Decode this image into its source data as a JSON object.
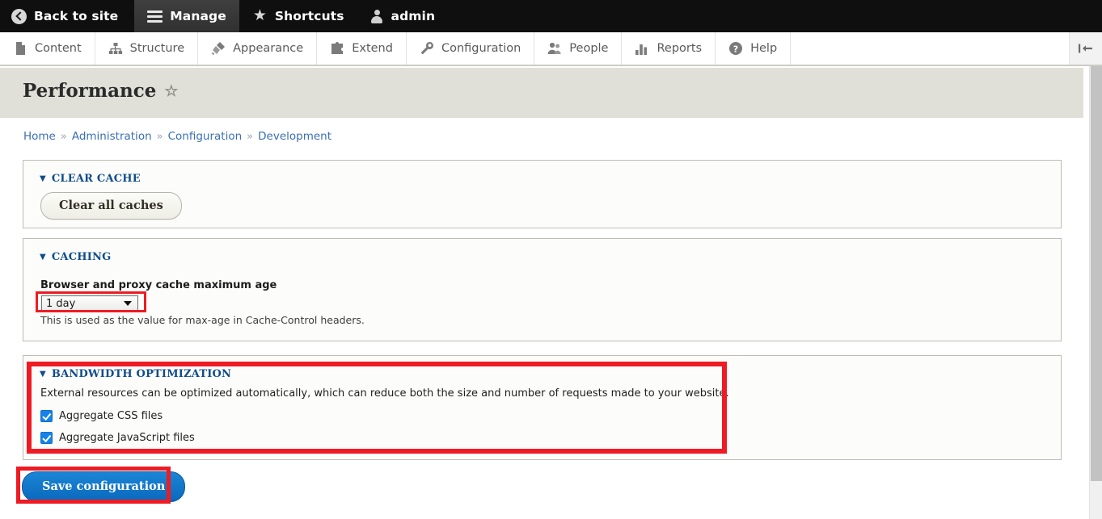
{
  "admin_bar": {
    "items": [
      {
        "label": "Back to site",
        "icon": "back-circle-icon",
        "active": false
      },
      {
        "label": "Manage",
        "icon": "hamburger-icon",
        "active": true
      },
      {
        "label": "Shortcuts",
        "icon": "star-icon",
        "active": false
      },
      {
        "label": "admin",
        "icon": "person-icon",
        "active": false
      }
    ]
  },
  "menu_bar": {
    "items": [
      {
        "label": "Content",
        "icon": "document-icon"
      },
      {
        "label": "Structure",
        "icon": "sitemap-icon"
      },
      {
        "label": "Appearance",
        "icon": "paintbrush-icon"
      },
      {
        "label": "Extend",
        "icon": "puzzle-icon"
      },
      {
        "label": "Configuration",
        "icon": "wrench-icon"
      },
      {
        "label": "People",
        "icon": "people-icon"
      },
      {
        "label": "Reports",
        "icon": "bar-chart-icon"
      },
      {
        "label": "Help",
        "icon": "question-mark-icon"
      }
    ],
    "collapse_icon": "collapse-toolbar-icon"
  },
  "page": {
    "title": "Performance",
    "favorite_icon": "star-outline-icon"
  },
  "breadcrumb": {
    "items": [
      "Home",
      "Administration",
      "Configuration",
      "Development"
    ],
    "separator": "»"
  },
  "clear_cache": {
    "legend": "CLEAR CACHE",
    "toggle": "▼",
    "button_label": "Clear all caches"
  },
  "caching": {
    "legend": "CACHING",
    "toggle": "▼",
    "field_label": "Browser and proxy cache maximum age",
    "select_value": "1 day",
    "description": "This is used as the value for max-age in Cache-Control headers."
  },
  "bandwidth": {
    "legend": "BANDWIDTH OPTIMIZATION",
    "toggle": "▼",
    "description": "External resources can be optimized automatically, which can reduce both the size and number of requests made to your website.",
    "checkboxes": [
      {
        "label": "Aggregate CSS files",
        "checked": true
      },
      {
        "label": "Aggregate JavaScript files",
        "checked": true
      }
    ]
  },
  "actions": {
    "save_label": "Save configuration"
  },
  "colors": {
    "admin_bar_bg": "#0f0f0f",
    "legend_blue": "#0f4c8a",
    "link_blue": "#3a6fb5",
    "primary_button": "#0b69bd",
    "checkbox_blue": "#1583e8",
    "annotation_red": "#ee1b24",
    "title_band": "#e0e0d8",
    "panel_bg": "#fcfcfa"
  }
}
